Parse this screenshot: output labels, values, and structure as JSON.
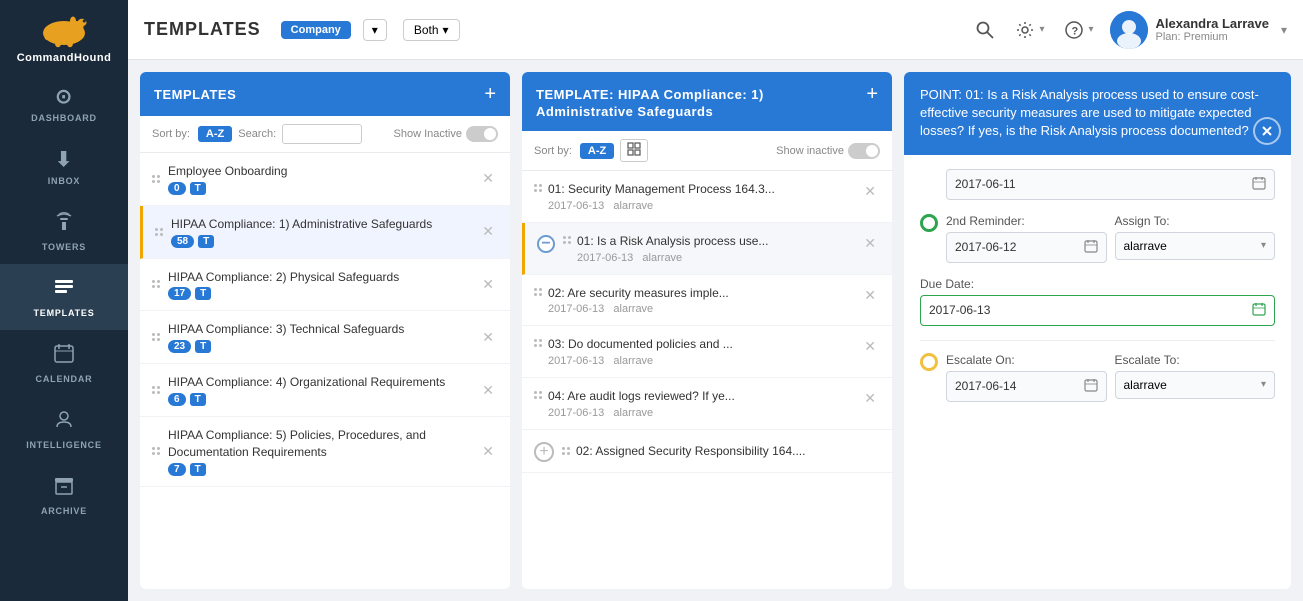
{
  "sidebar": {
    "logo_text": "CommandHound",
    "nav_items": [
      {
        "id": "dashboard",
        "label": "DASHBOARD",
        "icon": "⊙",
        "active": false
      },
      {
        "id": "inbox",
        "label": "INBOX",
        "icon": "⬇",
        "active": false
      },
      {
        "id": "towers",
        "label": "TOWERS",
        "icon": "📡",
        "active": false
      },
      {
        "id": "templates",
        "label": "TEMPLATES",
        "icon": "☰",
        "active": true
      },
      {
        "id": "calendar",
        "label": "CALENDAR",
        "icon": "📅",
        "active": false
      },
      {
        "id": "intelligence",
        "label": "INTELLIGENCE",
        "icon": "👤",
        "active": false
      },
      {
        "id": "archive",
        "label": "ARCHIVE",
        "icon": "🗃",
        "active": false
      }
    ]
  },
  "topbar": {
    "title": "TEMPLATES",
    "company_badge": "Company",
    "company_chevron": "▾",
    "both_label": "Both",
    "both_chevron": "▾",
    "search_icon": "🔍",
    "settings_icon": "⚙",
    "settings_chevron": "▾",
    "help_icon": "?",
    "help_chevron": "▾",
    "user_name": "Alexandra Larrave",
    "user_plan": "Plan: Premium",
    "user_chevron": "▾"
  },
  "left_column": {
    "header": "TEMPLATES",
    "sort_label": "Sort by:",
    "sort_btn": "A-Z",
    "search_label": "Search:",
    "search_placeholder": "",
    "show_inactive_label": "Show Inactive",
    "items": [
      {
        "title": "Employee Onboarding",
        "badge_num": "0",
        "badge_t": "T",
        "selected": false
      },
      {
        "title": "HIPAA Compliance: 1) Administrative Safeguards",
        "badge_num": "58",
        "badge_t": "T",
        "selected": true
      },
      {
        "title": "HIPAA Compliance: 2) Physical Safeguards",
        "badge_num": "17",
        "badge_t": "T",
        "selected": false
      },
      {
        "title": "HIPAA Compliance: 3) Technical Safeguards",
        "badge_num": "23",
        "badge_t": "T",
        "selected": false
      },
      {
        "title": "HIPAA Compliance: 4) Organizational Requirements",
        "badge_num": "6",
        "badge_t": "T",
        "selected": false
      },
      {
        "title": "HIPAA Compliance: 5) Policies, Procedures, and Documentation Requirements",
        "badge_num": "7",
        "badge_t": "T",
        "selected": false
      }
    ]
  },
  "mid_column": {
    "header": "TEMPLATE: HIPAA Compliance: 1) Administrative Safeguards",
    "sort_label": "Sort by:",
    "sort_btn": "A-Z",
    "show_inactive_label": "Show inactive",
    "items": [
      {
        "id": "item1",
        "title": "01: Security Management Process 164.3...",
        "date": "2017-06-13",
        "user": "alarrave",
        "selected": false,
        "has_minus": false
      },
      {
        "id": "item2",
        "title": "01: Is a Risk Analysis process use...",
        "date": "2017-06-13",
        "user": "alarrave",
        "selected": true,
        "has_minus": true
      },
      {
        "id": "item3",
        "title": "02: Are security measures imple...",
        "date": "2017-06-13",
        "user": "alarrave",
        "selected": false,
        "has_minus": false
      },
      {
        "id": "item4",
        "title": "03: Do documented policies and ...",
        "date": "2017-06-13",
        "user": "alarrave",
        "selected": false,
        "has_minus": false
      },
      {
        "id": "item5",
        "title": "04: Are audit logs reviewed? If ye...",
        "date": "2017-06-13",
        "user": "alarrave",
        "selected": false,
        "has_minus": false
      },
      {
        "id": "item6",
        "title": "02: Assigned Security Responsibility 164....",
        "date": "",
        "user": "",
        "selected": false,
        "has_minus": false,
        "is_add": true
      }
    ]
  },
  "right_panel": {
    "header_text": "POINT: 01: Is a Risk Analysis process used to ensure cost-effective security measures are used to mitigate expected losses? If yes, is the Risk Analysis process documented?",
    "date1_label": "",
    "date1_value": "2017-06-11",
    "reminder2_label": "2nd Reminder:",
    "assign_to_label": "Assign To:",
    "date2_value": "2017-06-12",
    "assign2_value": "alarrave",
    "due_date_label": "Due Date:",
    "due_date_value": "2017-06-13",
    "escalate_on_label": "Escalate On:",
    "escalate_to_label": "Escalate To:",
    "escalate_date_value": "2017-06-14",
    "escalate_to_value": "alarrave",
    "chevron": "▾"
  }
}
